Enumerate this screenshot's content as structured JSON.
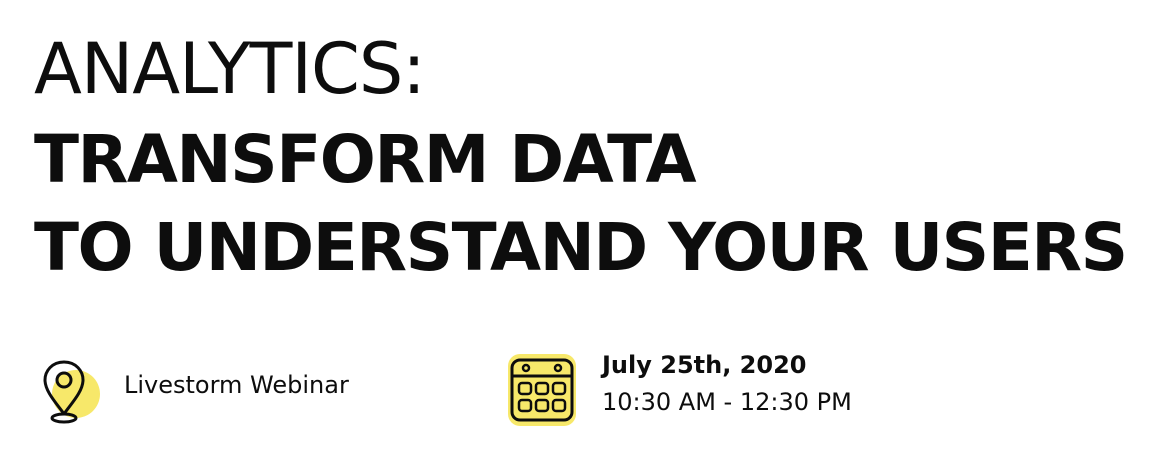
{
  "title": {
    "line1": "ANALYTICS:",
    "line2": "TRANSFORM DATA",
    "line3": "TO UNDERSTAND YOUR USERS"
  },
  "event": {
    "location_label": "Livestorm Webinar",
    "date": "July 25th, 2020",
    "time": "10:30 AM - 12:30 PM"
  },
  "icons": {
    "location": "map-pin-icon",
    "date": "calendar-icon"
  },
  "colors": {
    "background": "#ffffff",
    "text": "#0d0d0d",
    "accent_yellow": "#f7e86a"
  }
}
